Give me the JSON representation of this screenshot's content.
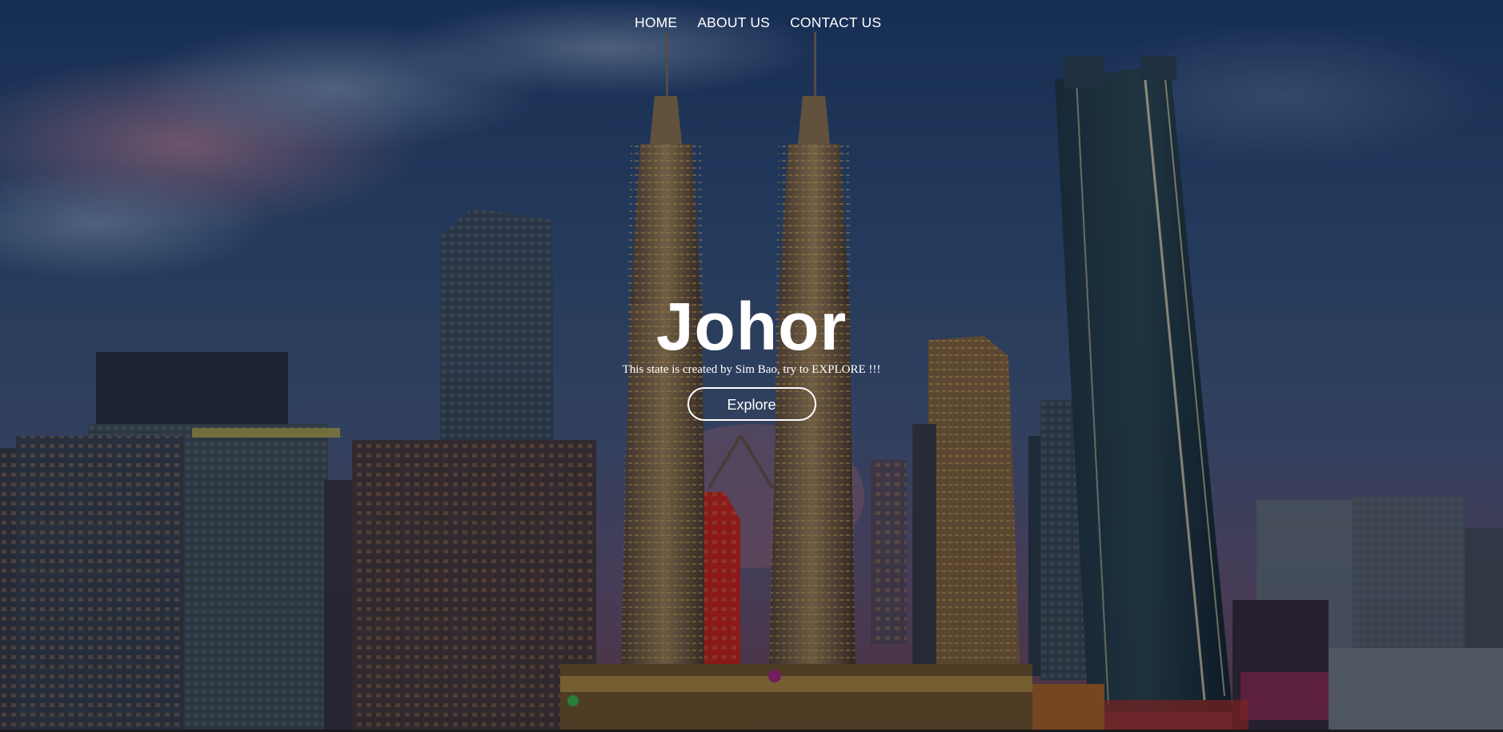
{
  "nav": {
    "items": [
      {
        "label": "HOME"
      },
      {
        "label": "ABOUT US"
      },
      {
        "label": "CONTACT US"
      }
    ]
  },
  "hero": {
    "title": "Johor",
    "subtitle": "This state is created by Sim Bao, try to EXPLORE !!!",
    "button_label": "Explore",
    "background": "night-city-skyline-photo"
  },
  "colors": {
    "text": "#ffffff",
    "sky_top": "#1d3a66",
    "sky_mid": "#3a5a86",
    "accent_glow": "#f0a040"
  }
}
